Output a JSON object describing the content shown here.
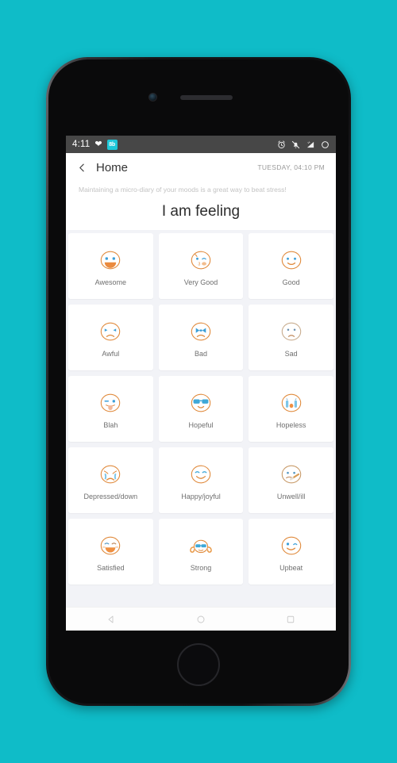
{
  "status_bar": {
    "time": "4:11",
    "heart_icon": "heart-icon",
    "app_badge_text": "8b",
    "icons": [
      "alarm-clock-icon",
      "bell-muted-icon",
      "signal-bars-icon",
      "battery-circle-icon"
    ]
  },
  "app_bar": {
    "back_icon": "chevron-left-icon",
    "title": "Home",
    "date": "TUESDAY, 04:10 PM"
  },
  "subtitle": "Maintaining a micro-diary of your moods is a great way to beat stress!",
  "section_heading": "I am feeling",
  "colors": {
    "background_teal": "#0fbcc8",
    "accent_orange": "#e08a3c",
    "accent_blue": "#3c9fd8",
    "grid_background": "#f2f3f7",
    "card_background": "#ffffff",
    "status_bar": "#474747"
  },
  "moods": [
    {
      "label": "Awesome",
      "face": "grinning-face-icon"
    },
    {
      "label": "Very Good",
      "face": "kissing-face-icon"
    },
    {
      "label": "Good",
      "face": "smiling-face-icon"
    },
    {
      "label": "Awful",
      "face": "distressed-face-icon"
    },
    {
      "label": "Bad",
      "face": "crossed-eyes-frowning-face-icon"
    },
    {
      "label": "Sad",
      "face": "sad-face-icon"
    },
    {
      "label": "Blah",
      "face": "tongue-out-winking-face-icon"
    },
    {
      "label": "Hopeful",
      "face": "sunglasses-face-icon"
    },
    {
      "label": "Hopeless",
      "face": "crying-face-icon"
    },
    {
      "label": "Depressed/down",
      "face": "weary-crying-face-icon"
    },
    {
      "label": "Happy/joyful",
      "face": "happy-face-icon"
    },
    {
      "label": "Unwell/ill",
      "face": "thermometer-face-icon"
    },
    {
      "label": "Satisfied",
      "face": "content-face-icon"
    },
    {
      "label": "Strong",
      "face": "flexing-arms-face-icon"
    },
    {
      "label": "Upbeat",
      "face": "winking-smiling-face-icon"
    }
  ],
  "nav_bar": {
    "back": "triangle-back-icon",
    "home": "circle-home-icon",
    "recents": "square-recents-icon"
  }
}
